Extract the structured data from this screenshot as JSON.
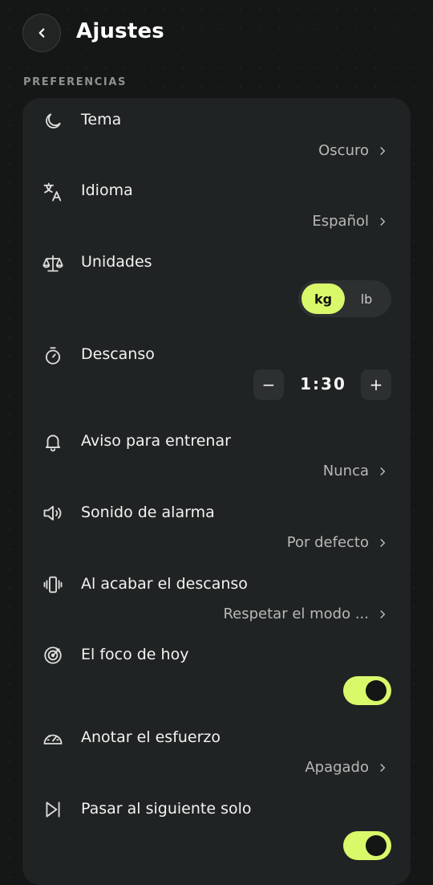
{
  "header": {
    "title": "Ajustes",
    "back_icon": "chevron-left-icon"
  },
  "section": {
    "label": "PREFERENCIAS"
  },
  "colors": {
    "accent": "#d9f86a",
    "background": "#151616",
    "card": "#202323"
  },
  "rows": {
    "tema": {
      "label": "Tema",
      "value": "Oscuro",
      "icon": "moon-icon"
    },
    "idioma": {
      "label": "Idioma",
      "value": "Español",
      "icon": "translate-icon"
    },
    "unidades": {
      "label": "Unidades",
      "options": [
        "kg",
        "lb"
      ],
      "selected": "kg",
      "icon": "scale-icon"
    },
    "descanso": {
      "label": "Descanso",
      "minus": "−",
      "value": "1:30",
      "plus": "+",
      "icon": "stopwatch-icon"
    },
    "aviso": {
      "label": "Aviso para entrenar",
      "value": "Nunca",
      "icon": "bell-icon"
    },
    "sonido": {
      "label": "Sonido de alarma",
      "value": "Por defecto",
      "icon": "speaker-icon"
    },
    "acabar": {
      "label": "Al acabar el descanso",
      "value": "Respetar el modo ...",
      "icon": "vibrate-icon"
    },
    "foco": {
      "label": "El foco de hoy",
      "enabled": true,
      "icon": "target-icon"
    },
    "esfuerzo": {
      "label": "Anotar el esfuerzo",
      "value": "Apagado",
      "icon": "gauge-icon"
    },
    "siguiente": {
      "label": "Pasar al siguiente solo",
      "enabled": true,
      "icon": "skip-next-icon"
    }
  }
}
